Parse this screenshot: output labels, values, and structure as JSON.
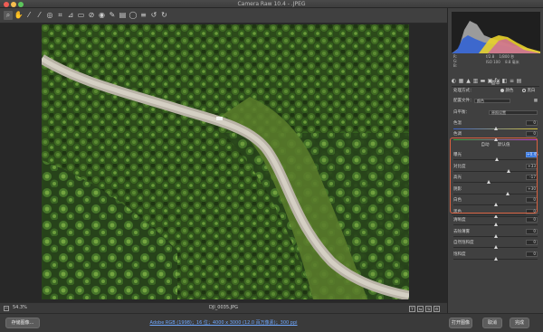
{
  "window": {
    "title": "Camera Raw 10.4 -  .JPEG"
  },
  "toolbar": {
    "tools": [
      {
        "icon": "zoom-icon",
        "glyph": "⌕"
      },
      {
        "icon": "hand-icon",
        "glyph": "✋"
      },
      {
        "icon": "white-balance-icon",
        "glyph": "⁄"
      },
      {
        "icon": "color-sampler-icon",
        "glyph": "⁄"
      },
      {
        "icon": "target-adjust-icon",
        "glyph": "◎"
      },
      {
        "icon": "crop-icon",
        "glyph": "⌗"
      },
      {
        "icon": "straighten-icon",
        "glyph": "⊿"
      },
      {
        "icon": "transform-icon",
        "glyph": "▭"
      },
      {
        "icon": "spot-removal-icon",
        "glyph": "⊘"
      },
      {
        "icon": "red-eye-icon",
        "glyph": "◉"
      },
      {
        "icon": "adjustment-brush-icon",
        "glyph": "✎"
      },
      {
        "icon": "graduated-filter-icon",
        "glyph": "▤"
      },
      {
        "icon": "radial-filter-icon",
        "glyph": "◯"
      },
      {
        "icon": "preferences-icon",
        "glyph": "≡"
      },
      {
        "icon": "rotate-ccw-icon",
        "glyph": "↺"
      },
      {
        "icon": "rotate-cw-icon",
        "glyph": "↻"
      }
    ]
  },
  "status": {
    "zoom": "54.3%",
    "filename": "DJI_0035.JPG"
  },
  "footer": {
    "save_label": "存储图像...",
    "info_link": "Adobe RGB (1998)；16 位；4000 x 3000 (12.0 百万像素)；300 ppi",
    "open_label": "打开图像",
    "cancel_label": "取消",
    "done_label": "完成"
  },
  "camera_info": {
    "line1_left": "f/2.8",
    "line1_right": "1/800 秒",
    "line2_left": "ISO 100",
    "line2_right": "8.8 毫米"
  },
  "panel": {
    "title": "基本",
    "process_label": "处理方式：",
    "process_color": "颜色",
    "process_bw": "黑白",
    "profile_label": "配置文件：",
    "profile_value": "颜色",
    "wb_label": "白平衡：",
    "wb_value": "原照设置",
    "temp_label": "色温",
    "temp_value": "0",
    "tint_label": "色调",
    "tint_value": "0",
    "auto_label": "自动",
    "default_label": "默认值",
    "sliders": [
      {
        "label": "曝光",
        "value": "+0.45",
        "pos": 0.52,
        "selected": true
      },
      {
        "label": "对比度",
        "value": "+33",
        "pos": 0.66
      },
      {
        "label": "高光",
        "value": "-17",
        "pos": 0.42
      },
      {
        "label": "阴影",
        "value": "+30",
        "pos": 0.65
      },
      {
        "label": "白色",
        "value": "0",
        "pos": 0.5
      },
      {
        "label": "黑色",
        "value": "0",
        "pos": 0.5
      }
    ],
    "presence": [
      {
        "label": "清晰度",
        "value": "0",
        "pos": 0.5
      },
      {
        "label": "去除薄雾",
        "value": "0",
        "pos": 0.5
      },
      {
        "label": "自然饱和度",
        "value": "0",
        "pos": 0.5
      },
      {
        "label": "饱和度",
        "value": "0",
        "pos": 0.5
      }
    ]
  }
}
